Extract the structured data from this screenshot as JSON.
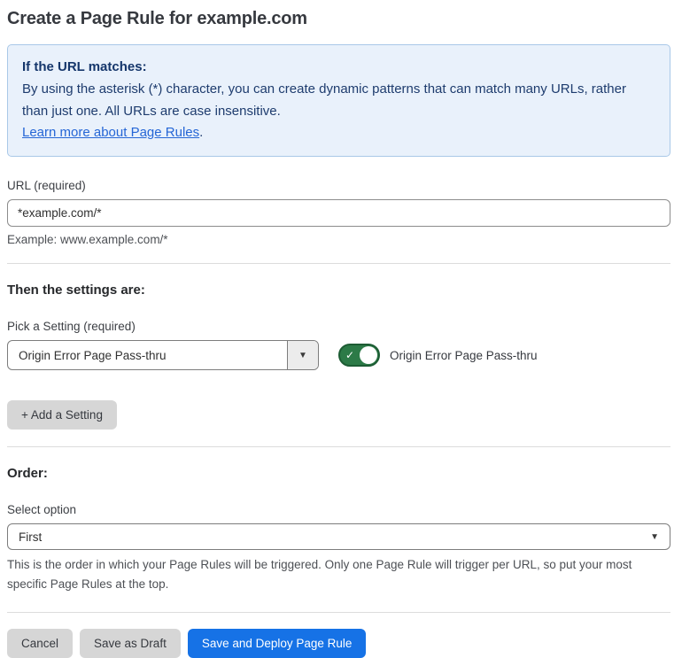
{
  "page": {
    "title": "Create a Page Rule for example.com"
  },
  "info_box": {
    "heading": "If the URL matches:",
    "body": "By using the asterisk (*) character, you can create dynamic patterns that can match many URLs, rather than just one. All URLs are case insensitive.",
    "link_text": "Learn more about Page Rules",
    "link_suffix": "."
  },
  "url_field": {
    "label": "URL (required)",
    "value": "*example.com/*",
    "helper": "Example: www.example.com/*"
  },
  "settings_section": {
    "heading": "Then the settings are:",
    "setting_label": "Pick a Setting (required)",
    "setting_value": "Origin Error Page Pass-thru",
    "dropdown_arrow": "▼",
    "toggle_state": "on",
    "toggle_check": "✓",
    "toggle_label": "Origin Error Page Pass-thru",
    "add_setting_label": "+ Add a Setting"
  },
  "order_section": {
    "heading": "Order:",
    "select_label": "Select option",
    "select_value": "First",
    "select_arrow": "▼",
    "helper": "This is the order in which your Page Rules will be triggered. Only one Page Rule will trigger per URL, so put your most specific Page Rules at the top."
  },
  "footer": {
    "cancel_label": "Cancel",
    "save_draft_label": "Save as Draft",
    "save_deploy_label": "Save and Deploy Page Rule"
  },
  "colors": {
    "info_bg": "#e9f1fb",
    "info_border": "#a9c8e8",
    "info_text": "#1e3c6e",
    "link_blue": "#2566d6",
    "toggle_green": "#2c7a47",
    "toggle_green_border": "#1d5c34",
    "primary_blue": "#1672e6",
    "button_gray": "#d6d6d6"
  }
}
